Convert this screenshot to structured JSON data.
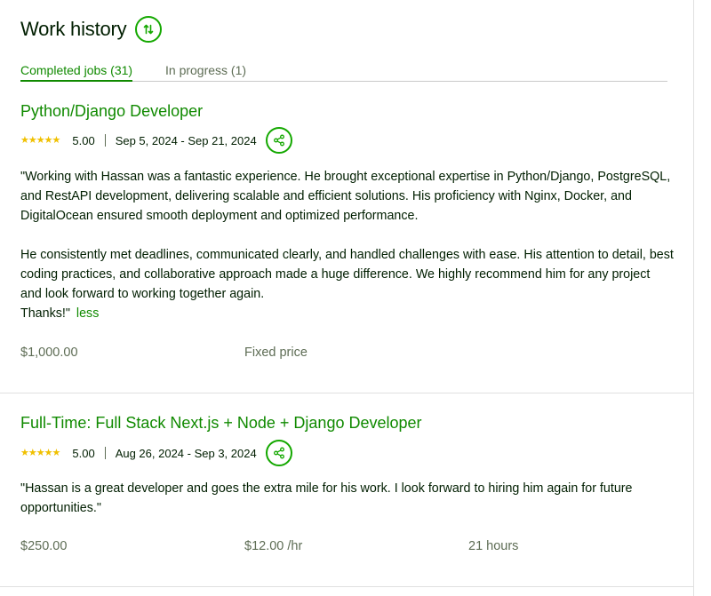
{
  "header": {
    "title": "Work history",
    "sort_icon": "sort-arrows-icon"
  },
  "tabs": [
    {
      "label": "Completed jobs (31)",
      "active": true
    },
    {
      "label": "In progress (1)",
      "active": false
    }
  ],
  "jobs": [
    {
      "title": "Python/Django Developer",
      "rating": "5.00",
      "stars": 5,
      "dates": "Sep 5, 2024 - Sep 21, 2024",
      "review_p1": "\"Working with Hassan was a fantastic experience. He brought exceptional expertise in Python/Django, PostgreSQL, and RestAPI development, delivering scalable and efficient solutions. His proficiency with Nginx, Docker, and DigitalOcean ensured smooth deployment and optimized performance.",
      "review_p2": "He consistently met deadlines, communicated clearly, and handled challenges with ease. His attention to detail, best coding practices, and collaborative approach made a huge difference. We highly recommend him for any project and look forward to working together again.",
      "review_p3": "Thanks!\"",
      "less_label": "less",
      "earned": "$1,000.00",
      "rate": "Fixed price"
    },
    {
      "title": "Full-Time: Full Stack Next.js + Node + Django Developer",
      "rating": "5.00",
      "stars": 5,
      "dates": "Aug 26, 2024 - Sep 3, 2024",
      "review_p1": "\"Hassan is a great developer and goes the extra mile for his work. I look forward to hiring him again for future opportunities.\"",
      "earned": "$250.00",
      "rate": "$12.00 /hr",
      "hours": "21 hours"
    }
  ],
  "colors": {
    "accent": "#108a00",
    "star": "#f0c000",
    "muted": "#5e6d55",
    "text": "#001e00"
  }
}
